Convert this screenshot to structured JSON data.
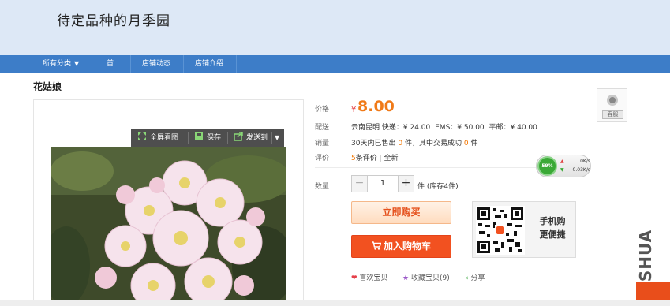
{
  "header": {
    "shop_title": "待定品种的月季园"
  },
  "nav": {
    "items": [
      {
        "label": "所有分类",
        "arrow": "▼"
      },
      {
        "label": "首页"
      },
      {
        "label": "店铺动态"
      },
      {
        "label": "店铺介绍"
      }
    ]
  },
  "product": {
    "name": "花姑娘"
  },
  "toolbar": {
    "fullscreen": "全屏看图",
    "save": "保存",
    "send": "发送到"
  },
  "info": {
    "price_label": "价格",
    "currency": "¥",
    "price": "8.00",
    "shipping_label": "配送",
    "shipping_origin": "云南昆明",
    "shipping_express": "快递：¥ 24.00",
    "shipping_ems": "EMS：¥ 50.00",
    "shipping_post": "平邮：¥ 40.00",
    "sales_label": "销量",
    "sales_prefix": "30天内已售出",
    "sales_count": "0",
    "sales_mid": "件，其中交易成功",
    "sales_success": "0",
    "sales_suffix": "件",
    "review_label": "评价",
    "review_count": "5",
    "review_text": "条评价",
    "review_sep": "|",
    "review_tag": "全新",
    "qty_label": "数量",
    "qty_minus": "−",
    "qty_value": "1",
    "qty_plus": "+",
    "qty_suffix": "件 (库存4件)"
  },
  "actions": {
    "buy_now": "立即购买",
    "cart_icon": "cart-icon",
    "add_to_cart": "加入购物车"
  },
  "qr": {
    "text_line1": "手机购",
    "text_line2": "更便捷"
  },
  "social": {
    "like": "喜欢宝贝",
    "favorite": "收藏宝贝(9)",
    "share": "分享"
  },
  "speed_widget": {
    "percent": "59%",
    "up": "0K/s",
    "down": "0.03K/s"
  },
  "side": {
    "thumb_label": "客服"
  },
  "watermark": "MSHUA",
  "colors": {
    "nav": "#3d7dc8",
    "header_bg": "#dde8f6",
    "price": "#f07a18",
    "cart": "#f25120"
  }
}
